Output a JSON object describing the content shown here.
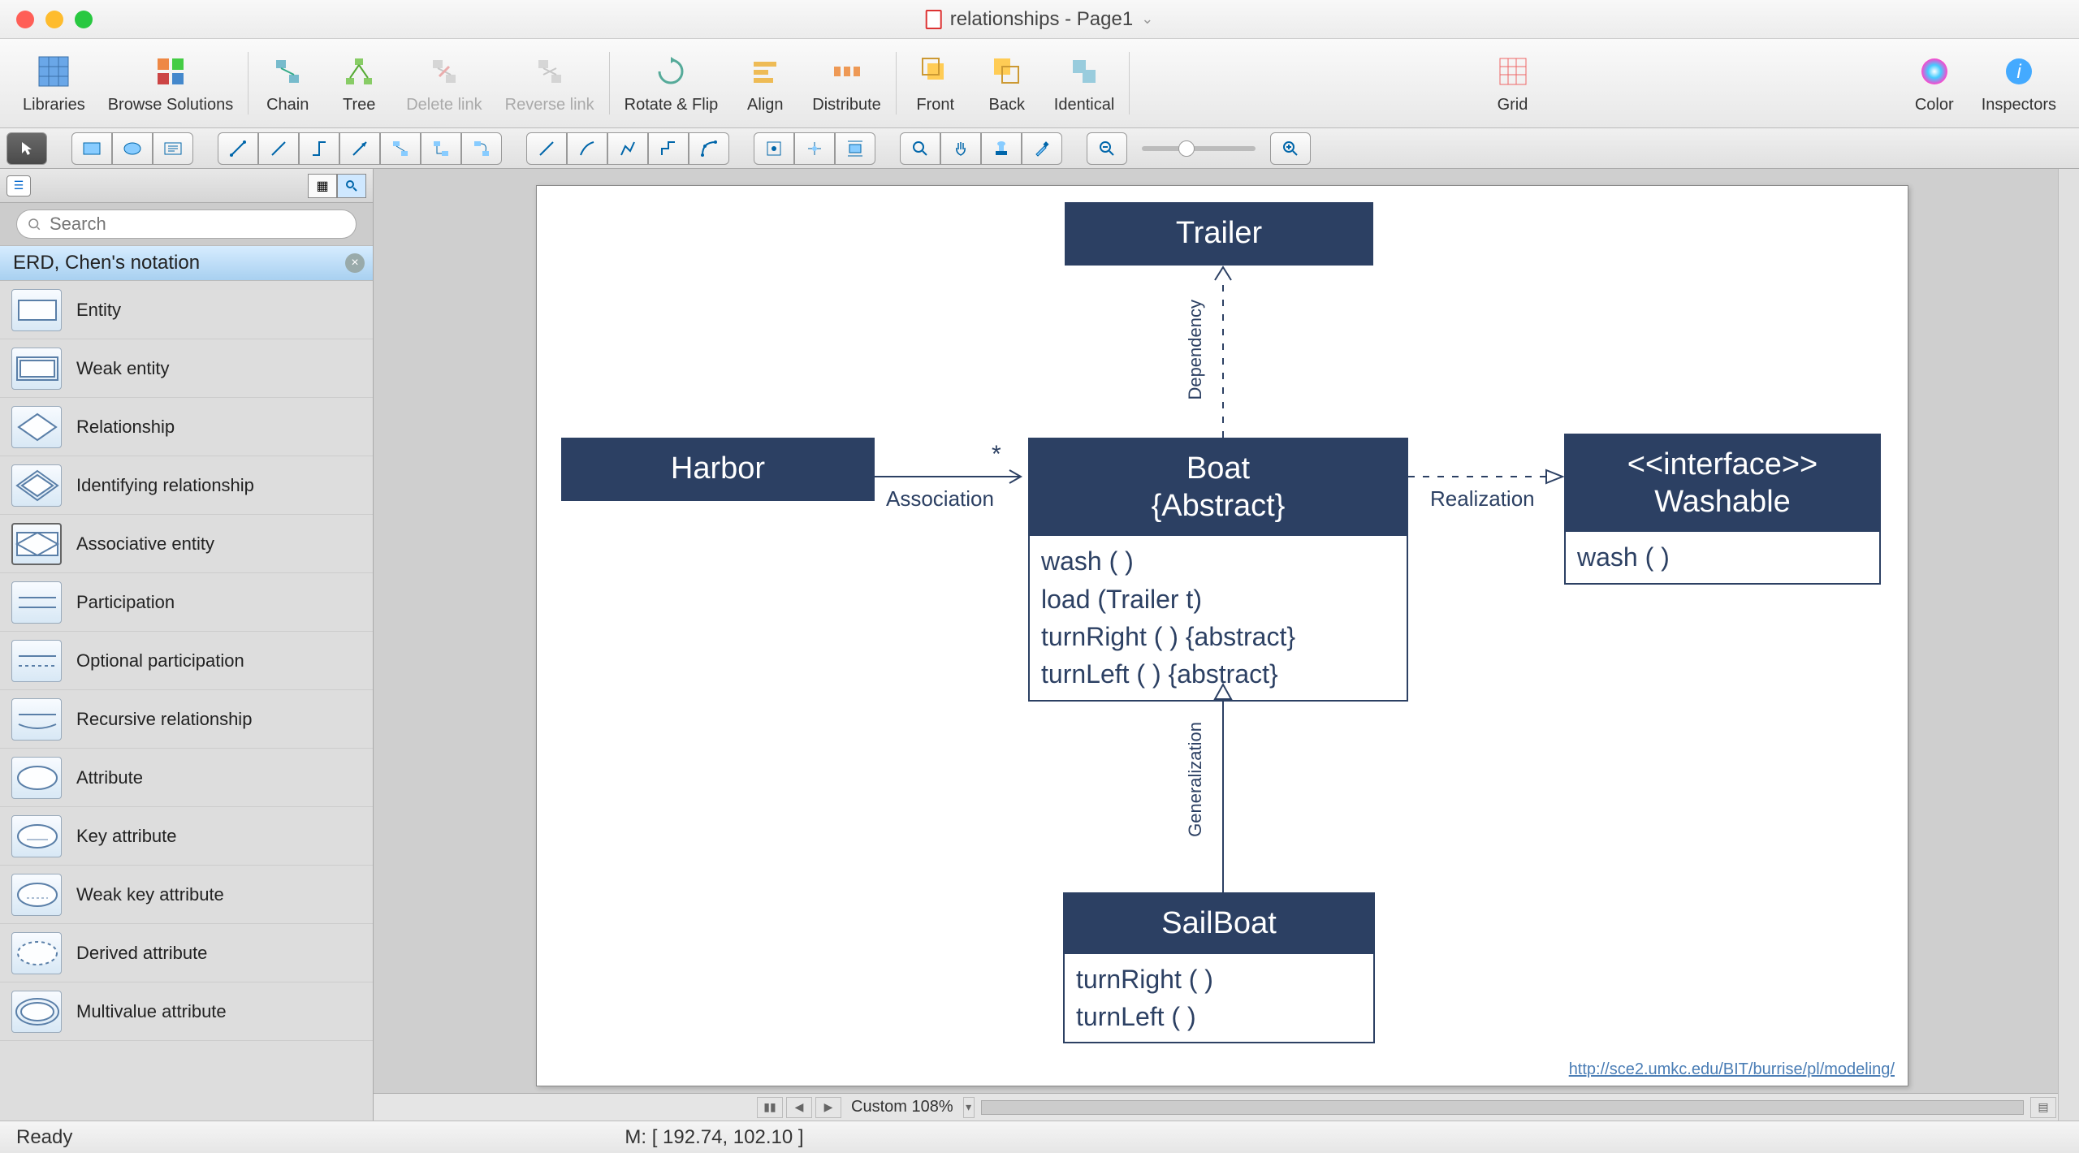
{
  "window": {
    "title": "relationships - Page1"
  },
  "toolbar": {
    "groups": [
      [
        "Libraries",
        "Browse Solutions"
      ],
      [
        "Chain",
        "Tree",
        "Delete link",
        "Reverse link"
      ],
      [
        "Rotate & Flip",
        "Align",
        "Distribute"
      ],
      [
        "Front",
        "Back",
        "Identical"
      ],
      [
        "Grid"
      ],
      [
        "Color",
        "Inspectors"
      ]
    ]
  },
  "sidebar": {
    "search_placeholder": "Search",
    "category": "ERD, Chen's notation",
    "shapes": [
      {
        "label": "Entity",
        "kind": "rect"
      },
      {
        "label": "Weak entity",
        "kind": "rect2"
      },
      {
        "label": "Relationship",
        "kind": "diamond"
      },
      {
        "label": "Identifying relationship",
        "kind": "diamond2"
      },
      {
        "label": "Associative entity",
        "kind": "diamond-rect"
      },
      {
        "label": "Participation",
        "kind": "line"
      },
      {
        "label": "Optional participation",
        "kind": "dashline"
      },
      {
        "label": "Recursive relationship",
        "kind": "loop"
      },
      {
        "label": "Attribute",
        "kind": "ellipse"
      },
      {
        "label": "Key attribute",
        "kind": "ellipse-u"
      },
      {
        "label": "Weak key attribute",
        "kind": "ellipse-du"
      },
      {
        "label": "Derived attribute",
        "kind": "ellipse-dash"
      },
      {
        "label": "Multivalue attribute",
        "kind": "ellipse2"
      }
    ]
  },
  "diagram": {
    "trailer": {
      "title": "Trailer"
    },
    "harbor": {
      "title": "Harbor"
    },
    "boat": {
      "title": "Boat",
      "sub": "{Abstract}",
      "methods": [
        "wash ( )",
        "load (Trailer t)",
        "turnRight ( ) {abstract}",
        "turnLeft ( ) {abstract}"
      ]
    },
    "washable": {
      "stereo": "<<interface>>",
      "title": "Washable",
      "methods": [
        "wash ( )"
      ]
    },
    "sailboat": {
      "title": "SailBoat",
      "methods": [
        "turnRight ( )",
        "turnLeft ( )"
      ]
    },
    "rel": {
      "assoc": "Association",
      "assoc_mult": "*",
      "dep": "Dependency",
      "gen": "Generalization",
      "real": "Realization"
    },
    "link": "http://sce2.umkc.edu/BIT/burrise/pl/modeling/"
  },
  "footer": {
    "zoom": "Custom 108%",
    "ready": "Ready",
    "coords": "M: [ 192.74, 102.10 ]"
  },
  "colors": {
    "brand": "#2c4063"
  }
}
